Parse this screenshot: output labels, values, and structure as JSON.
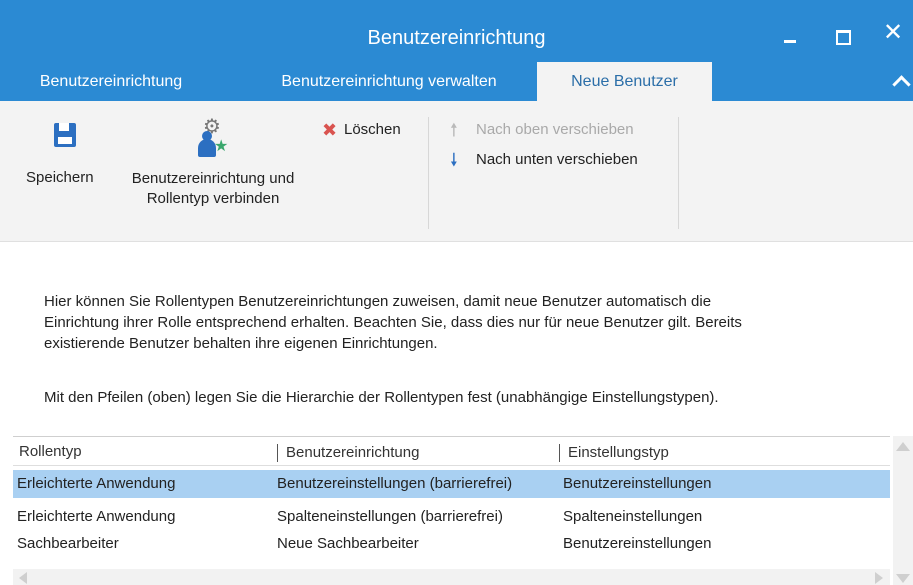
{
  "window": {
    "title": "Benutzereinrichtung",
    "controls": {
      "minimize": "minimize",
      "maximize": "maximize",
      "close": "✕"
    }
  },
  "tabs": [
    {
      "label": "Benutzereinrichtung",
      "active": false
    },
    {
      "label": "Benutzereinrichtung verwalten",
      "active": false
    },
    {
      "label": "Neue Benutzer",
      "active": true
    }
  ],
  "ribbon": {
    "save_label": "Speichern",
    "connect_label_line1": "Benutzereinrichtung und",
    "connect_label_line2": "Rollentyp verbinden",
    "delete_label": "Löschen",
    "move_up_label": "Nach oben verschieben",
    "move_down_label": "Nach unten verschieben",
    "icons": {
      "save": "save-icon",
      "connect": "gear-user-star-icon",
      "delete": "x-icon",
      "move_up": "arrow-up-icon",
      "move_down": "arrow-down-icon"
    }
  },
  "description": {
    "line1": "Hier können Sie Rollentypen Benutzereinrichtungen zuweisen, damit neue Benutzer automatisch die",
    "line2": "Einrichtung ihrer Rolle entsprechend erhalten. Beachten Sie, dass dies nur für neue Benutzer gilt. Bereits",
    "line3": "existierende Benutzer behalten ihre eigenen Einrichtungen.",
    "line4": "Mit den Pfeilen (oben) legen Sie die Hierarchie der Rollentypen fest (unabhängige Einstellungstypen)."
  },
  "grid": {
    "columns": [
      "Rollentyp",
      "Benutzereinrichtung",
      "Einstellungstyp"
    ],
    "rows": [
      [
        "Erleichterte Anwendung",
        "Benutzereinstellungen (barrierefrei)",
        "Benutzereinstellungen"
      ],
      [
        "Erleichterte Anwendung",
        "Spalteneinstellungen (barrierefrei)",
        "Spalteneinstellungen"
      ],
      [
        "Sachbearbeiter",
        "Neue Sachbearbeiter",
        "Benutzereinstellungen"
      ]
    ],
    "selected_row": 0
  },
  "colors": {
    "accent": "#2b8ad3",
    "ribbon_bg": "#f3f3f3",
    "selection": "#a9d0f2",
    "delete_red": "#d9534f",
    "icon_blue": "#2c6fc1"
  }
}
